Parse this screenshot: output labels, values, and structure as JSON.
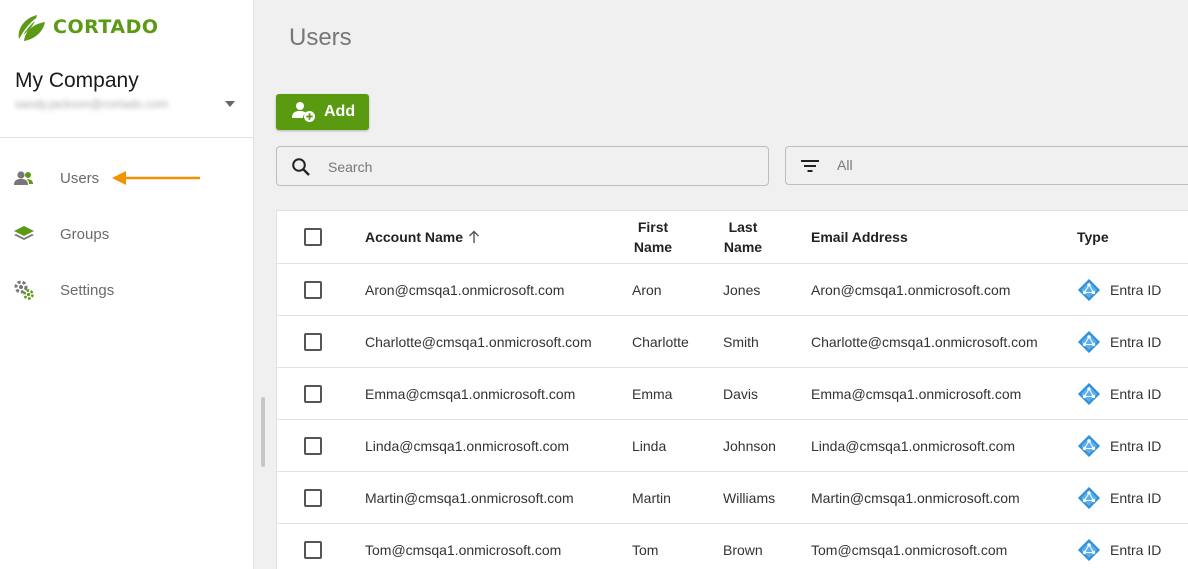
{
  "brand": {
    "name": "CORTADO",
    "color": "#5c9a16"
  },
  "company": {
    "name": "My Company",
    "email": "sandy.jackson@cortado.com"
  },
  "nav": [
    {
      "label": "Users",
      "icon": "users-icon",
      "active": true
    },
    {
      "label": "Groups",
      "icon": "layers-icon"
    },
    {
      "label": "Settings",
      "icon": "gears-icon"
    }
  ],
  "page": {
    "title": "Users"
  },
  "toolbar": {
    "add_label": "Add"
  },
  "search": {
    "placeholder": "Search"
  },
  "filter": {
    "value": "All"
  },
  "table": {
    "headers": {
      "account": "Account Name",
      "first_1": "First",
      "first_2": "Name",
      "last_1": "Last",
      "last_2": "Name",
      "email": "Email Address",
      "type": "Type"
    },
    "rows": [
      {
        "account": "Aron@cmsqa1.onmicrosoft.com",
        "first": "Aron",
        "last": "Jones",
        "email": "Aron@cmsqa1.onmicrosoft.com",
        "type": "Entra ID"
      },
      {
        "account": "Charlotte@cmsqa1.onmicrosoft.com",
        "first": "Charlotte",
        "last": "Smith",
        "email": "Charlotte@cmsqa1.onmicrosoft.com",
        "type": "Entra ID"
      },
      {
        "account": "Emma@cmsqa1.onmicrosoft.com",
        "first": "Emma",
        "last": "Davis",
        "email": "Emma@cmsqa1.onmicrosoft.com",
        "type": "Entra ID"
      },
      {
        "account": "Linda@cmsqa1.onmicrosoft.com",
        "first": "Linda",
        "last": "Johnson",
        "email": "Linda@cmsqa1.onmicrosoft.com",
        "type": "Entra ID"
      },
      {
        "account": "Martin@cmsqa1.onmicrosoft.com",
        "first": "Martin",
        "last": "Williams",
        "email": "Martin@cmsqa1.onmicrosoft.com",
        "type": "Entra ID"
      },
      {
        "account": "Tom@cmsqa1.onmicrosoft.com",
        "first": "Tom",
        "last": "Brown",
        "email": "Tom@cmsqa1.onmicrosoft.com",
        "type": "Entra ID"
      }
    ]
  },
  "colors": {
    "accent": "#5a9a10",
    "arrow": "#f39200",
    "entra": "#2f8fd8"
  }
}
